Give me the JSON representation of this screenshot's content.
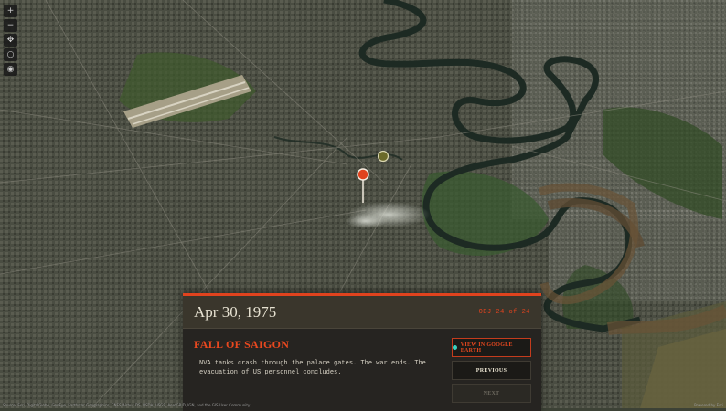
{
  "map": {
    "background": "#3d4236",
    "river_color": "#1f2b24",
    "marker_active_color": "#e0431e",
    "marker_inactive_color": "#6b6a2a"
  },
  "zoom_controls": [
    {
      "name": "zoom-in-button",
      "glyph": "+"
    },
    {
      "name": "zoom-out-button",
      "glyph": "−"
    },
    {
      "name": "pan-button",
      "glyph": "✥"
    },
    {
      "name": "compass-button",
      "glyph": "○"
    },
    {
      "name": "locate-button",
      "glyph": "◉"
    }
  ],
  "panel": {
    "date": "Apr 30, 1975",
    "counter": "OBJ 24 of 24",
    "title": "FALL OF SAIGON",
    "description": "NVA tanks crash through the palace gates. The war ends. The evacuation of US personnel concludes.",
    "buttons": {
      "earth": "VIEW IN GOOGLE EARTH",
      "previous": "PREVIOUS",
      "next": "NEXT"
    },
    "accent": "#e0431e"
  },
  "attribution": {
    "left": "Source: Esri, DigitalGlobe, GeoEye, Earthstar Geographics, CNES/Airbus DS, USDA, USGS, AeroGRID, IGN, and the GIS User Community",
    "right": "Powered by Esri"
  }
}
